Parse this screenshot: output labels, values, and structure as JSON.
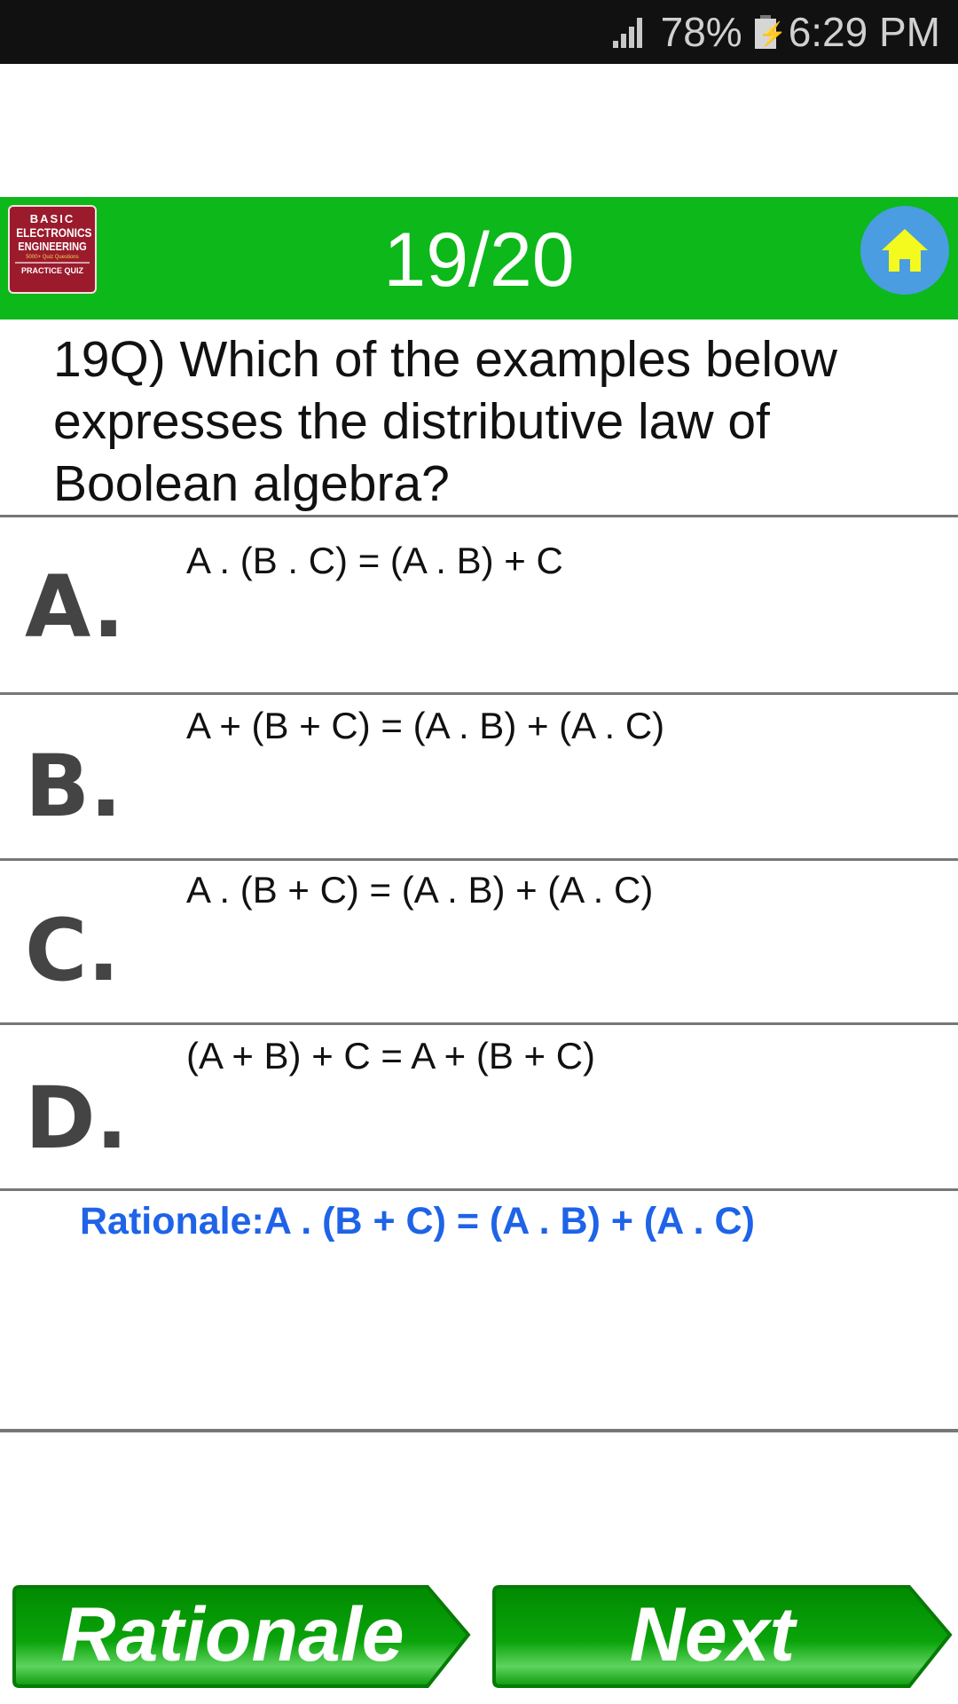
{
  "status_bar": {
    "battery": "78%",
    "time": "6:29 PM",
    "icons": [
      "signal-icon",
      "battery-charging-icon"
    ]
  },
  "header": {
    "logo": {
      "line1": "BASIC",
      "line2": "ELECTRONICS",
      "line3": "ENGINEERING",
      "line4": "5000+ Quiz Questions",
      "line5": "PRACTICE QUIZ"
    },
    "progress": "19/20",
    "home_icon": "home-icon",
    "colors": {
      "bar": "#0cb81a",
      "home_bg": "#4a9de0",
      "home_glyph": "#f4fa1e"
    }
  },
  "question": {
    "text": "19Q) Which of the examples below expresses the distributive law of Boolean algebra?"
  },
  "options": [
    {
      "letter": "A.",
      "text": "A . (B . C) = (A . B) + C"
    },
    {
      "letter": "B.",
      "text": "A + (B + C) = (A . B) + (A . C)"
    },
    {
      "letter": "C.",
      "text": "A . (B + C) = (A . B) + (A . C)"
    },
    {
      "letter": "D.",
      "text": "(A + B) + C = A + (B + C)"
    }
  ],
  "rationale": {
    "text": "Rationale:A . (B + C) = (A . B) + (A . C)",
    "color": "#1e63e8"
  },
  "buttons": {
    "rationale_label": "Rationale",
    "next_label": "Next",
    "color": "#0a9a0a"
  }
}
